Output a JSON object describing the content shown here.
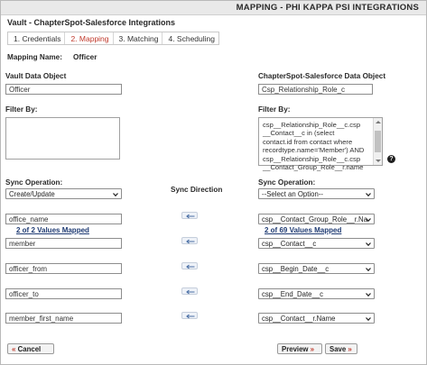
{
  "header": {
    "title": "MAPPING - PHI KAPPA PSI INTEGRATIONS"
  },
  "panel": {
    "title": "Vault - ChapterSpot-Salesforce Integrations"
  },
  "tabs": [
    {
      "label": "1. Credentials"
    },
    {
      "label": "2. Mapping",
      "active": true
    },
    {
      "label": "3. Matching"
    },
    {
      "label": "4. Scheduling"
    }
  ],
  "mapping_name": {
    "label": "Mapping Name:",
    "value": "Officer"
  },
  "left": {
    "data_object_label": "Vault Data Object",
    "data_object_value": "Officer",
    "filter_label": "Filter By:",
    "filter_value": "",
    "sync_label": "Sync Operation:",
    "sync_value": "Create/Update",
    "values_mapped": "2 of 2 Values Mapped"
  },
  "center": {
    "sync_direction_label": "Sync Direction"
  },
  "right": {
    "data_object_label": "ChapterSpot-Salesforce Data Object",
    "data_object_value": "Csp_Relationship_Role_c",
    "filter_label": "Filter By:",
    "filter_value": "csp__Relationship_Role__c.csp\n__Contact__c in (select\ncontact.id from contact where\nrecordtype.name='Member') AND\ncsp__Relationship_Role__c.csp\n__Contact_Group_Role__r.name",
    "sync_label": "Sync Operation:",
    "sync_value": "--Select an Option--",
    "values_mapped": "2 of 69 Values Mapped"
  },
  "mappings": [
    {
      "vault_field": "office_name",
      "salesforce_field": "csp__Contact_Group_Role__r.Na"
    },
    {
      "vault_field": "member",
      "salesforce_field": "csp__Contact__c"
    },
    {
      "vault_field": "officer_from",
      "salesforce_field": "csp__Begin_Date__c"
    },
    {
      "vault_field": "officer_to",
      "salesforce_field": "csp__End_Date__c"
    },
    {
      "vault_field": "member_first_name",
      "salesforce_field": "csp__Contact__r.Name"
    }
  ],
  "footer": {
    "cancel_label": "Cancel",
    "preview_label": "Preview",
    "save_label": "Save"
  },
  "colors": {
    "accent_red": "#c0392b",
    "link_blue": "#1f3b73",
    "arrow_blue": "#4a6fa5"
  },
  "icons": {
    "help": "question-circle-icon",
    "arrow": "arrow-left-icon"
  }
}
